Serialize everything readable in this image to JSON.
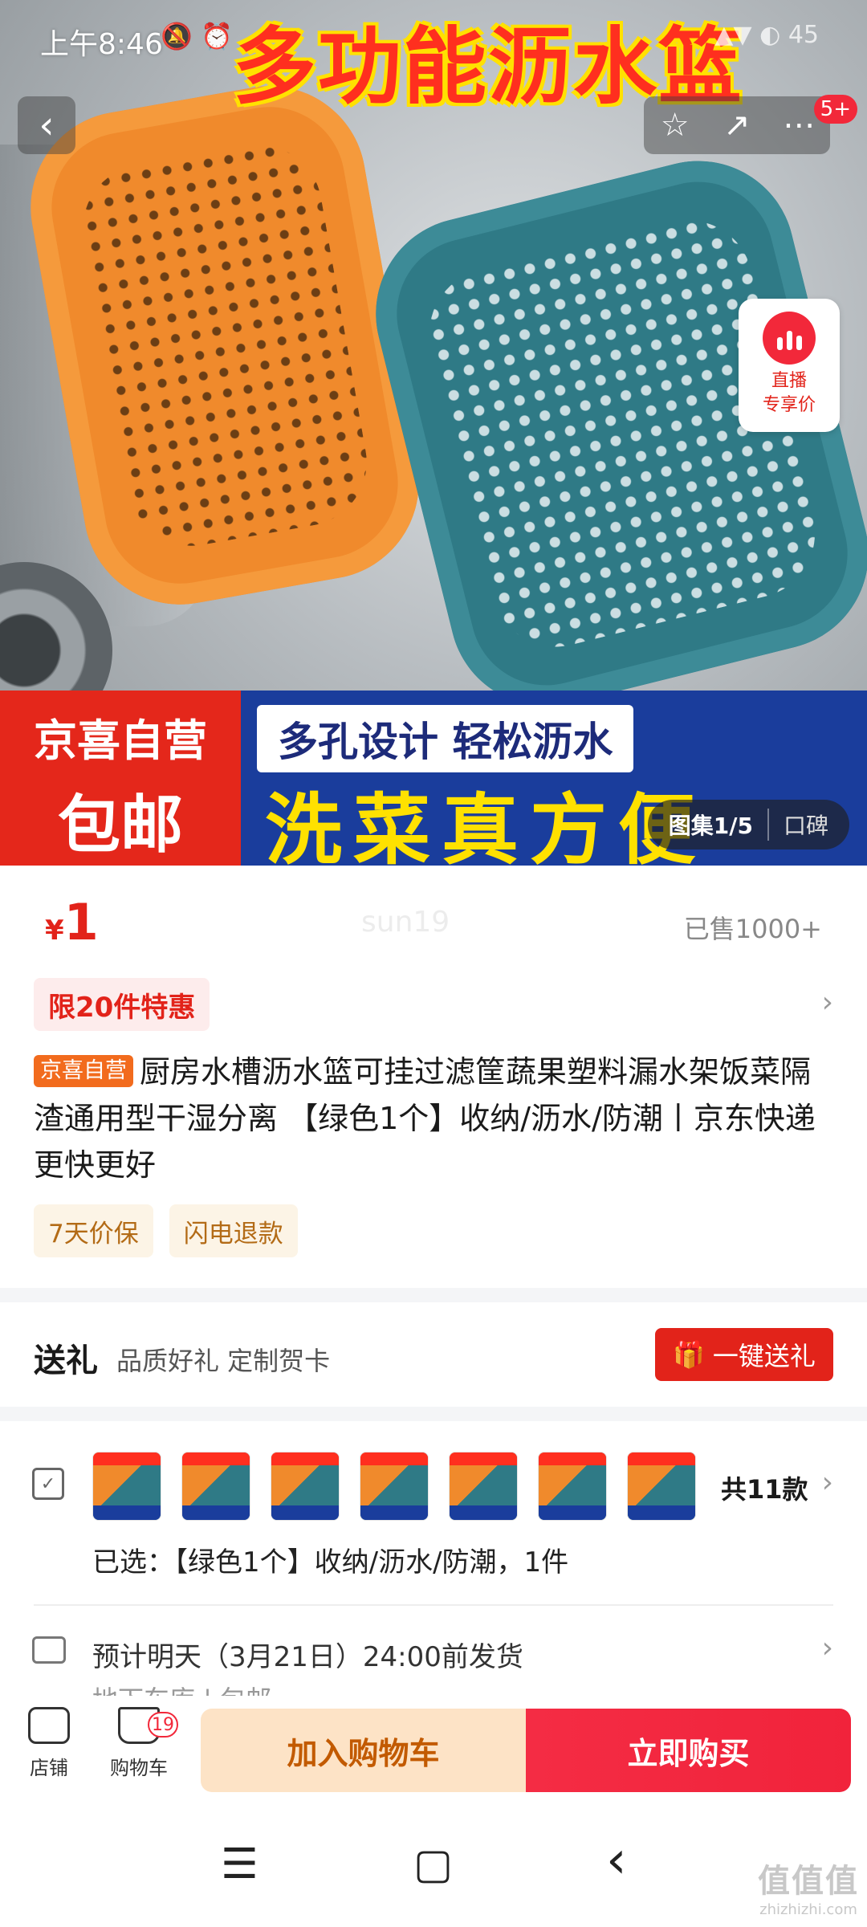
{
  "status_bar": {
    "time": "上午8:46",
    "icons": "🔕 ⏰",
    "right": "▲▼ ◐ 45"
  },
  "hero": {
    "title": "多功能沥水篮",
    "promo_left_line1": "京喜自营",
    "promo_left_line2": "包邮",
    "promo_sub": "多孔设计 轻松沥水",
    "promo_main": "洗菜真方便",
    "gallery_label": "图集1/5",
    "reviews_label": "口碑",
    "message_badge": "5+",
    "live_label_line1": "直播",
    "live_label_line2": "专享价"
  },
  "nav": {
    "back_icon": "‹",
    "star_icon": "☆",
    "share_icon": "↗",
    "more_icon": "⋯"
  },
  "price": {
    "currency": "¥",
    "value": "1",
    "watermark": "sun19",
    "sold": "已售1000+"
  },
  "deal": {
    "label": "限20件特惠"
  },
  "product": {
    "self_tag": "京喜自营",
    "title": "厨房水槽沥水篮可挂过滤筐蔬果塑料漏水架饭菜隔渣通用型干湿分离 【绿色1个】收纳/沥水/防潮丨京东快递 更快更好"
  },
  "services": [
    "7天价保",
    "闪电退款"
  ],
  "gift": {
    "title": "送礼",
    "subtitle": "品质好礼 定制贺卡",
    "button": "一键送礼",
    "button_icon": "🎁"
  },
  "variants": {
    "count_label": "共11款",
    "selected": "已选：【绿色1个】收纳/沥水/防潮，1件"
  },
  "shipping": {
    "text": "预计明天（3月21日）24:00前发货",
    "sub": "地下车库 | 包邮"
  },
  "bottom": {
    "store_label": "店铺",
    "cart_label": "购物车",
    "cart_count": "19",
    "add_to_cart": "加入购物车",
    "buy_now": "立即购买"
  },
  "system_nav": {
    "menu": "☰",
    "home": "▢",
    "back": "‹"
  },
  "corner_watermark": {
    "logo": "值值值",
    "domain": "zhizhizhi.com"
  },
  "colors": {
    "accent_red": "#e2231a",
    "buy_red": "#f42c44",
    "add_cart_bg": "#fde3c6",
    "self_tag_orange": "#f26b1d"
  }
}
